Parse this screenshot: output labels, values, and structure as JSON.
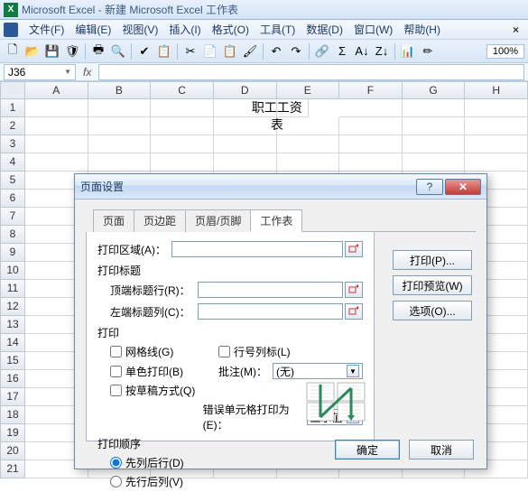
{
  "window": {
    "title": "Microsoft Excel - 新建 Microsoft Excel 工作表"
  },
  "menu": {
    "file": "文件(F)",
    "edit": "编辑(E)",
    "view": "视图(V)",
    "insert": "插入(I)",
    "format": "格式(O)",
    "tools": "工具(T)",
    "data": "数据(D)",
    "window": "窗口(W)",
    "help": "帮助(H)"
  },
  "toolbar": {
    "zoom": "100%"
  },
  "nameBox": "J36",
  "columns": [
    "A",
    "B",
    "C",
    "D",
    "E",
    "F",
    "G",
    "H"
  ],
  "rows": [
    "1",
    "2",
    "3",
    "4",
    "5",
    "6",
    "7",
    "8",
    "9",
    "10",
    "11",
    "12",
    "13",
    "14",
    "15",
    "16",
    "17",
    "18",
    "19",
    "20",
    "21"
  ],
  "sheetTitle": "职工工资表",
  "dialog": {
    "title": "页面设置",
    "tabs": {
      "page": "页面",
      "margins": "页边距",
      "headerFooter": "页眉/页脚",
      "sheet": "工作表"
    },
    "sheet": {
      "printArea": "打印区域(A)：",
      "printTitlesSection": "打印标题",
      "rowsToRepeat": "顶端标题行(R)：",
      "colsToRepeat": "左端标题列(C)：",
      "printSection": "打印",
      "gridlines": "网格线(G)",
      "blackWhite": "单色打印(B)",
      "draft": "按草稿方式(Q)",
      "rowColHeadings": "行号列标(L)",
      "commentsLabel": "批注(M)：",
      "commentsValue": "(无)",
      "errorsLabel": "错误单元格打印为(E)：",
      "errorsValue": "显示值",
      "orderSection": "打印顺序",
      "downThenOver": "先列后行(D)",
      "overThenDown": "先行后列(V)"
    },
    "side": {
      "print": "打印(P)...",
      "preview": "打印预览(W)",
      "options": "选项(O)..."
    },
    "ok": "确定",
    "cancel": "取消"
  }
}
